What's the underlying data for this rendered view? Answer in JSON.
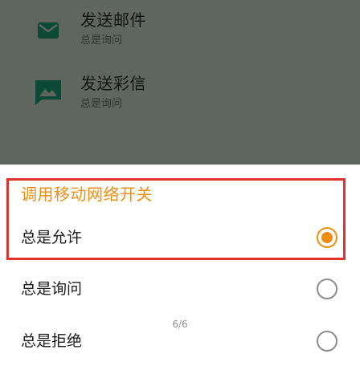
{
  "background_list": {
    "items": [
      {
        "title": "发送邮件",
        "subtitle": "总是询问",
        "icon": "mail-icon"
      },
      {
        "title": "发送彩信",
        "subtitle": "总是询问",
        "icon": "mms-image-icon"
      }
    ]
  },
  "sheet": {
    "title": "调用移动网络开关",
    "options": [
      {
        "label": "总是允许",
        "selected": true
      },
      {
        "label": "总是询问",
        "selected": false
      },
      {
        "label": "总是拒绝",
        "selected": false
      }
    ],
    "page_indicator": "6/6"
  },
  "colors": {
    "accent": "#f08e12",
    "highlight_border": "#e0332b",
    "dim_background": "#5f6660",
    "icon_green": "#0c4a36"
  }
}
